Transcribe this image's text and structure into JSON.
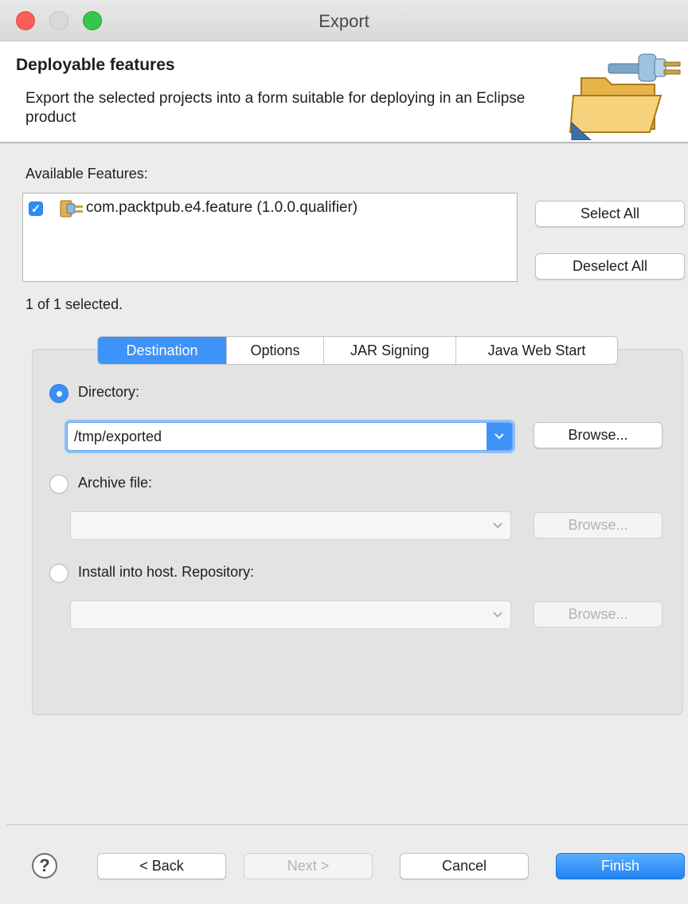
{
  "window": {
    "title": "Export"
  },
  "banner": {
    "title": "Deployable features",
    "description": "Export the selected projects into a form suitable for deploying in an Eclipse product",
    "icon": "folder-export-icon"
  },
  "features": {
    "label": "Available Features:",
    "items": [
      {
        "label": "com.packtpub.e4.feature (1.0.0.qualifier)",
        "checked": true,
        "icon": "feature-plugin-icon"
      }
    ],
    "select_all": "Select All",
    "deselect_all": "Deselect All",
    "selection_status": "1 of 1 selected."
  },
  "tabs": [
    {
      "label": "Destination",
      "active": true
    },
    {
      "label": "Options",
      "active": false
    },
    {
      "label": "JAR Signing",
      "active": false
    },
    {
      "label": "Java Web Start",
      "active": false
    }
  ],
  "destination": {
    "directory": {
      "label": "Directory:",
      "selected": true,
      "value": "/tmp/exported",
      "browse": "Browse..."
    },
    "archive": {
      "label": "Archive file:",
      "selected": false,
      "value": "",
      "browse": "Browse..."
    },
    "repository": {
      "label": "Install into host. Repository:",
      "selected": false,
      "value": "",
      "browse": "Browse..."
    }
  },
  "footer": {
    "help": "?",
    "back": "< Back",
    "next": "Next >",
    "cancel": "Cancel",
    "finish": "Finish"
  },
  "colors": {
    "accent": "#3d93f8",
    "close": "#fc5f57",
    "maximize": "#34c84a"
  }
}
